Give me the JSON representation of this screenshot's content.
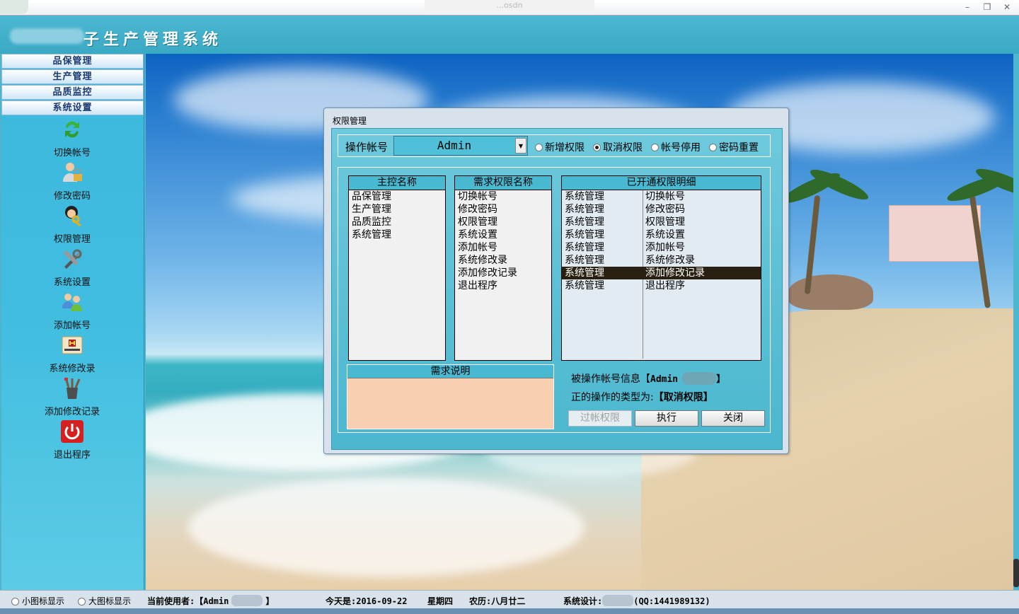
{
  "window": {
    "caption": "...osdn",
    "min_icon": "minimize-icon",
    "max_icon": "restore-icon",
    "close_icon": "close-icon"
  },
  "header": {
    "title": "子生产管理系统"
  },
  "sidebar": {
    "menus": [
      "品保管理",
      "生产管理",
      "品质监控",
      "系统设置"
    ],
    "items": [
      {
        "label": "切换帐号",
        "icon": "switch-account-icon"
      },
      {
        "label": "修改密码",
        "icon": "change-password-icon"
      },
      {
        "label": "权限管理",
        "icon": "permission-management-icon"
      },
      {
        "label": "系统设置",
        "icon": "tools-icon"
      },
      {
        "label": "添加帐号",
        "icon": "add-account-icon"
      },
      {
        "label": "系统修改录",
        "icon": "history-icon"
      },
      {
        "label": "添加修改记录",
        "icon": "tools-cup-icon"
      },
      {
        "label": "退出程序",
        "icon": "power-icon"
      }
    ]
  },
  "dialog": {
    "title": "权限管理",
    "op_account_label": "操作帐号",
    "account_value": "Admin",
    "radios": [
      {
        "label": "新增权限",
        "checked": false
      },
      {
        "label": "取消权限",
        "checked": true
      },
      {
        "label": "帐号停用",
        "checked": false
      },
      {
        "label": "密码重置",
        "checked": false
      }
    ],
    "main_list": {
      "header": "主控名称",
      "items": [
        "品保管理",
        "生产管理",
        "品质监控",
        "系统管理"
      ]
    },
    "perm_list": {
      "header": "需求权限名称",
      "items": [
        "切换帐号",
        "修改密码",
        "权限管理",
        "系统设置",
        "添加帐号",
        "系统修改录",
        "添加修改记录",
        "退出程序"
      ]
    },
    "detail_list": {
      "header": "已开通权限明细",
      "selected_index": 6,
      "rows": [
        [
          "系统管理",
          "切换帐号"
        ],
        [
          "系统管理",
          "修改密码"
        ],
        [
          "系统管理",
          "权限管理"
        ],
        [
          "系统管理",
          "系统设置"
        ],
        [
          "系统管理",
          "添加帐号"
        ],
        [
          "系统管理",
          "系统修改录"
        ],
        [
          "系统管理",
          "添加修改记录"
        ],
        [
          "系统管理",
          "退出程序"
        ]
      ]
    },
    "desc": {
      "header": "需求说明",
      "value": ""
    },
    "info1_label": "被操作帐号信息【",
    "info1_value": "Admin",
    "info1_end": "】",
    "info2_label": "正的操作的类型为:",
    "info2_value": "【取消权限】",
    "buttons": {
      "transfer": "过帐权限",
      "execute": "执行",
      "close": "关闭"
    }
  },
  "status": {
    "small_icon": "小图标显示",
    "large_icon": "大图标显示",
    "user_label": "当前使用者:【Admin",
    "user_end": "】",
    "today_label": "今天是:2016-09-22",
    "weekday": "星期四",
    "lunar": "农历:八月廿二",
    "designer_label": "系统设计:",
    "qq": "(QQ:1441989132)"
  },
  "colors": {
    "accent": "#49b9d2",
    "selection": "#2a2012",
    "desc_bg": "#f8cfb1"
  }
}
